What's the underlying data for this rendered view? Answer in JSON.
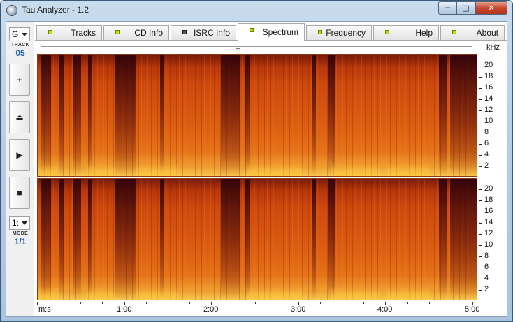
{
  "window": {
    "title": "Tau Analyzer - 1.2",
    "min_label": "─",
    "max_label": "□",
    "close_label": "✕"
  },
  "sidebar": {
    "track_selector": "G",
    "track_caption": "TRACK",
    "track_value": "05",
    "buttons": [
      {
        "name": "add-button",
        "icon": "+"
      },
      {
        "name": "eject-button",
        "icon": "⏏"
      },
      {
        "name": "play-button",
        "icon": "▶"
      },
      {
        "name": "stop-button",
        "icon": "■"
      }
    ],
    "mode_selector": "1:",
    "mode_caption": "MODE",
    "mode_value": "1/1"
  },
  "tabs": [
    {
      "label": "Tracks",
      "led": "green",
      "active": false
    },
    {
      "label": "CD Info",
      "led": "green",
      "active": false
    },
    {
      "label": "ISRC Info",
      "led": "dark",
      "active": false
    },
    {
      "label": "Spectrum",
      "led": "green",
      "active": true
    },
    {
      "label": "Frequency",
      "led": "green",
      "active": false
    },
    {
      "label": "Help",
      "led": "green",
      "active": false
    },
    {
      "label": "About",
      "led": "green",
      "active": false
    }
  ],
  "spectrum": {
    "y_unit": "kHz",
    "y_ticks": [
      "20",
      "18",
      "16",
      "14",
      "12",
      "10",
      "8",
      "6",
      "4",
      "2"
    ],
    "x_unit": "m:s",
    "x_ticks": [
      "1:00",
      "2:00",
      "3:00",
      "4:00",
      "5:00"
    ],
    "colors": {
      "low": "#7a1a08",
      "mid": "#d65510",
      "high": "#f7c850"
    }
  }
}
